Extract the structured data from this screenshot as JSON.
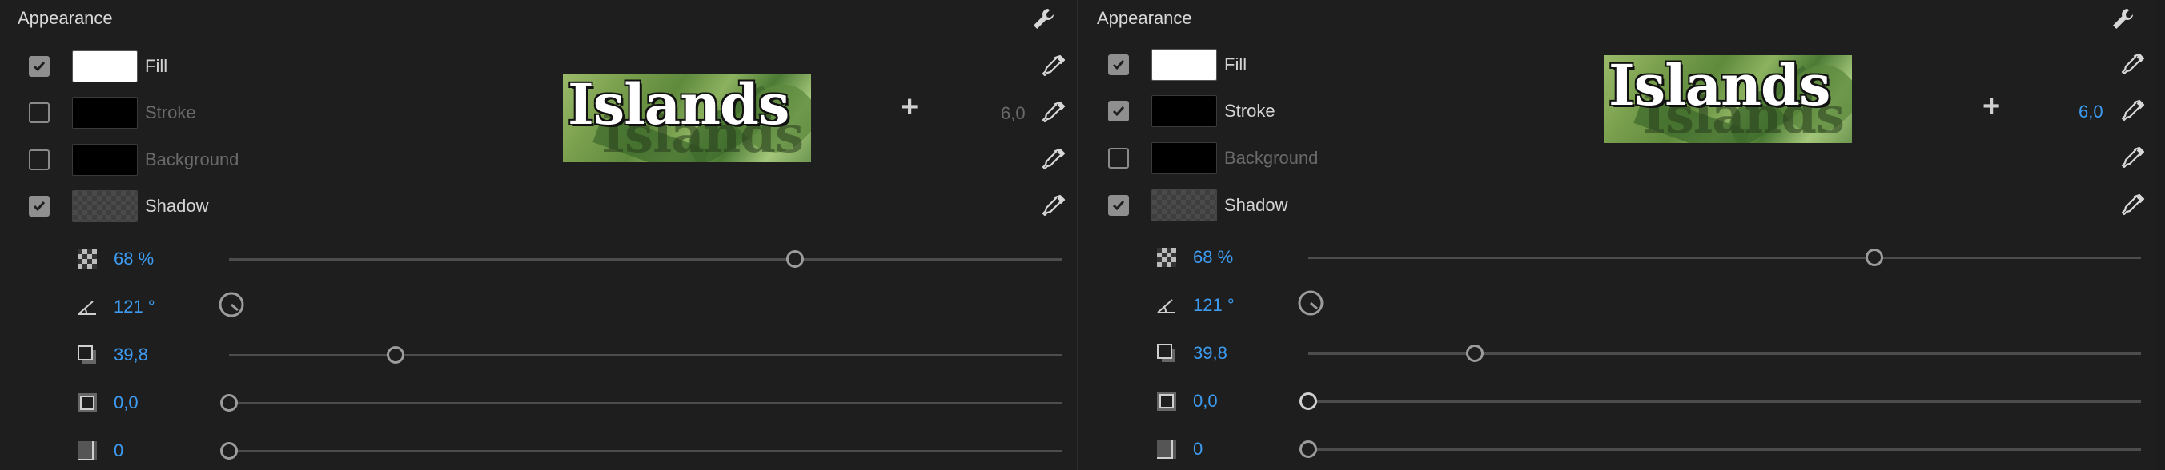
{
  "panels": [
    {
      "title": "Appearance",
      "rows": [
        {
          "label": "Fill",
          "checked": true,
          "swatch": "white",
          "dim": false
        },
        {
          "label": "Stroke",
          "checked": false,
          "swatch": "black",
          "dim": true
        },
        {
          "label": "Background",
          "checked": false,
          "swatch": "black",
          "dim": true
        },
        {
          "label": "Shadow",
          "checked": true,
          "swatch": "shadow",
          "dim": false
        }
      ],
      "preview_text": "Islands",
      "stroke_width": "6,0",
      "stroke_width_active": false,
      "shadow": {
        "opacity": "68 %",
        "angle": "121 °",
        "distance": "39,8",
        "size": "0,0",
        "blur": "0"
      },
      "slider_levels": {
        "opacity": 0.68,
        "distance": 0.2,
        "size": 0.0,
        "blur": 0.0
      }
    },
    {
      "title": "Appearance",
      "rows": [
        {
          "label": "Fill",
          "checked": true,
          "swatch": "white",
          "dim": false
        },
        {
          "label": "Stroke",
          "checked": true,
          "swatch": "black",
          "dim": false
        },
        {
          "label": "Background",
          "checked": false,
          "swatch": "black",
          "dim": true
        },
        {
          "label": "Shadow",
          "checked": true,
          "swatch": "shadow",
          "dim": false
        }
      ],
      "preview_text": "Islands",
      "stroke_width": "6,0",
      "stroke_width_active": true,
      "shadow": {
        "opacity": "68 %",
        "angle": "121 °",
        "distance": "39,8",
        "size": "0,0",
        "blur": "0"
      },
      "slider_levels": {
        "opacity": 0.68,
        "distance": 0.2,
        "size": 0.0,
        "blur": 0.0
      }
    }
  ],
  "colors": {
    "accent": "#3d9cf2",
    "background": "#1e1e1e",
    "knob": "#9c9c9c"
  }
}
